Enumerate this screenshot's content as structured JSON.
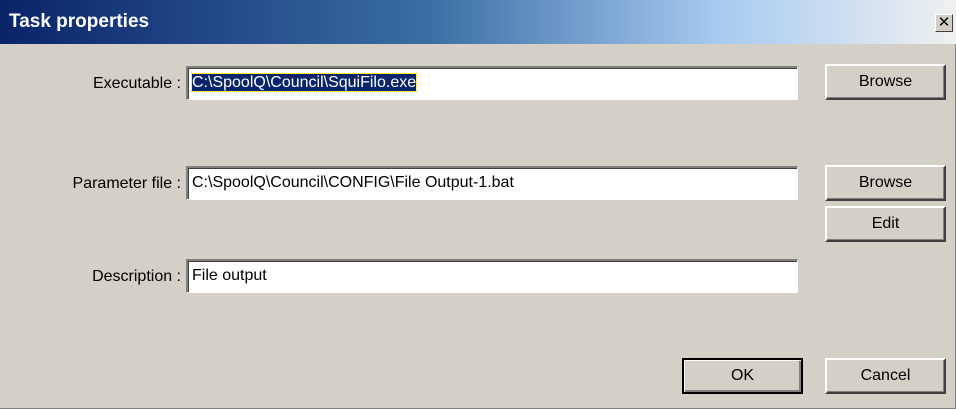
{
  "window": {
    "title": "Task properties",
    "close_glyph": "✕"
  },
  "form": {
    "executable_label": "Executable :",
    "executable_value": "C:\\SpoolQ\\Council\\SquiFilo.exe",
    "parameter_label": "Parameter file :",
    "parameter_value": "C:\\SpoolQ\\Council\\CONFIG\\File Output-1.bat",
    "description_label": "Description :",
    "description_value": "File output"
  },
  "buttons": {
    "browse_executable": "Browse",
    "browse_parameter": "Browse",
    "edit": "Edit",
    "ok": "OK",
    "cancel": "Cancel"
  },
  "colors": {
    "titlebar_start": "#0a246a",
    "face": "#d4d0c8",
    "selection": "#0a246a"
  }
}
